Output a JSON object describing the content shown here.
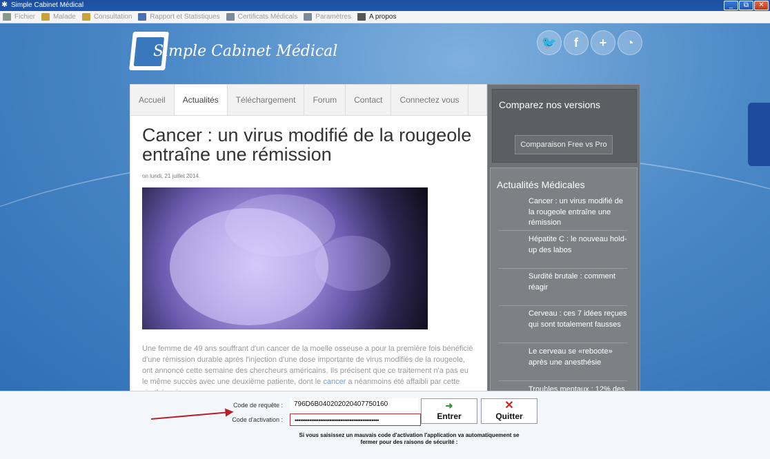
{
  "window": {
    "title": "Simple Cabinet Médical",
    "buttons": [
      "_",
      "⧉",
      "✕"
    ]
  },
  "menu": [
    {
      "label": "Fichier",
      "icon": "file-menu-icon",
      "color": "#8a9a8a"
    },
    {
      "label": "Malade",
      "icon": "folder-icon",
      "color": "#c9a23a"
    },
    {
      "label": "Consultation",
      "icon": "folder-icon",
      "color": "#c9a23a"
    },
    {
      "label": "Rapport et Statistiques",
      "icon": "book-icon",
      "color": "#4a6fb5"
    },
    {
      "label": "Certificats Médicals",
      "icon": "certificate-icon",
      "color": "#7a8a9a"
    },
    {
      "label": "Paramètres",
      "icon": "settings-icon",
      "color": "#7a8a9a"
    },
    {
      "label": "A propos",
      "icon": "about-icon",
      "color": "#555"
    }
  ],
  "site": {
    "logo_text": "Simple Cabinet Médical",
    "social": [
      "twitter-icon",
      "facebook-icon",
      "plus-icon",
      "rss-icon"
    ],
    "social_glyphs": [
      "🐦",
      "f",
      "+",
      "◔"
    ],
    "tabs": [
      "Accueil",
      "Actualités",
      "Téléchargement",
      "Forum",
      "Contact",
      "Connectez vous"
    ],
    "selected_tab": "Actualités",
    "article": {
      "title": "Cancer : un virus modifié de la rougeole entraîne une rémission",
      "date": "on lundi, 21 juillet 2014.",
      "body_before_link": "Une femme de 49 ans souffrant d'un cancer de la moelle osseuse a pour la première fois bénéficié d'une rémission durable après l'injection d'une dose importante de virus modifiés de la rougeole, ont annoncé cette semaine des chercheurs américains. Ils précisent que ce traitement n'a pas eu le même succès avec une deuxième patiente, dont le ",
      "link": "cancer",
      "body_after_link": " a néanmoins été affaibli par cette virothérapie."
    },
    "compare": {
      "heading": "Comparez nos versions",
      "button": "Comparaison Free vs Pro"
    },
    "news": {
      "heading": "Actualités Médicales",
      "items": [
        "Cancer : un virus modifié de la rougeole entraîne une rémission",
        "Hépatite C : le nouveau hold-up des labos",
        "Surdité brutale : comment réagir",
        "Cerveau : ces 7 idées reçues qui sont totalement fausses",
        "Le cerveau se «reboote» après une anesthésie",
        "Troubles mentaux : 12% des"
      ]
    }
  },
  "activation": {
    "request_label": "Code de requête :",
    "request_value": "796D6B040202020407750160",
    "activation_label": "Code d'activation :",
    "activation_value": "••••••••••••••••••••••••••••••••••••••••••••••",
    "enter_label": "Entrer",
    "quit_label": "Quitter",
    "warning": "Si vous saisissez un mauvais code d'activation l'application va automatiquement se fermer pour des raisons de sécurité :"
  }
}
